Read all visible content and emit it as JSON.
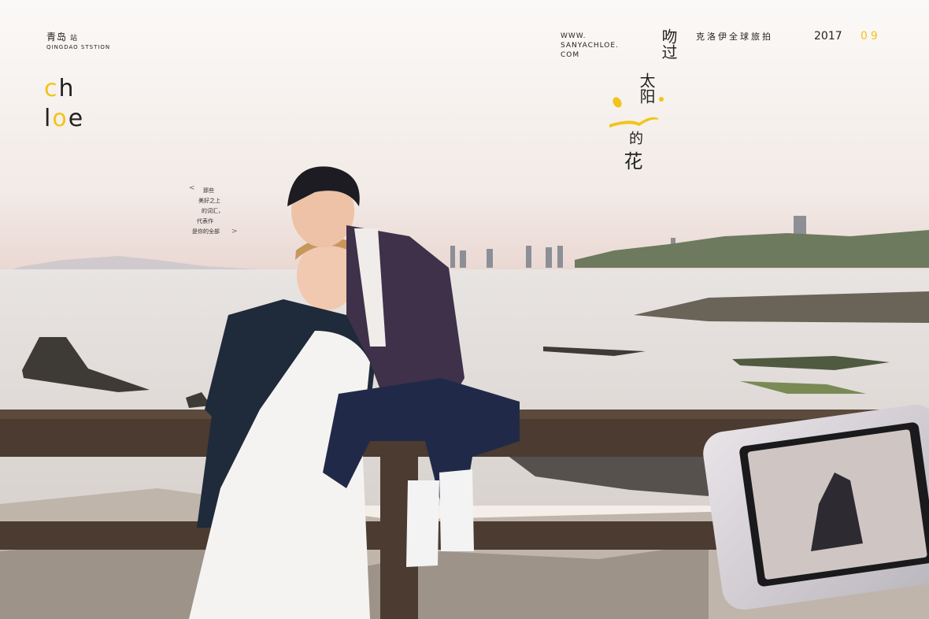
{
  "header": {
    "city_cn": "青岛",
    "city_suffix": "站",
    "city_en": "QINGDAO STSTION",
    "website_line1": "WWW.",
    "website_line2": "SANYACHLOE.",
    "website_line3": "COM",
    "tour_title": "克洛伊全球旅拍",
    "year": "2017",
    "month": "09"
  },
  "logo": {
    "line1": "ch",
    "line2": "loe",
    "accent_color": "#f2c418"
  },
  "headline": {
    "part1": "吻过",
    "part2": "太阳",
    "part3": "的",
    "part4": "花"
  },
  "poem": {
    "lines": [
      "那些",
      "美好之上",
      "的词汇，",
      "代表作",
      "是你的全部"
    ],
    "open_mark": "<",
    "close_mark": ">"
  },
  "colors": {
    "sky": "#f4ede8",
    "sea": "#e2dedb",
    "rail": "#4b3b30",
    "accent": "#f2c418"
  }
}
